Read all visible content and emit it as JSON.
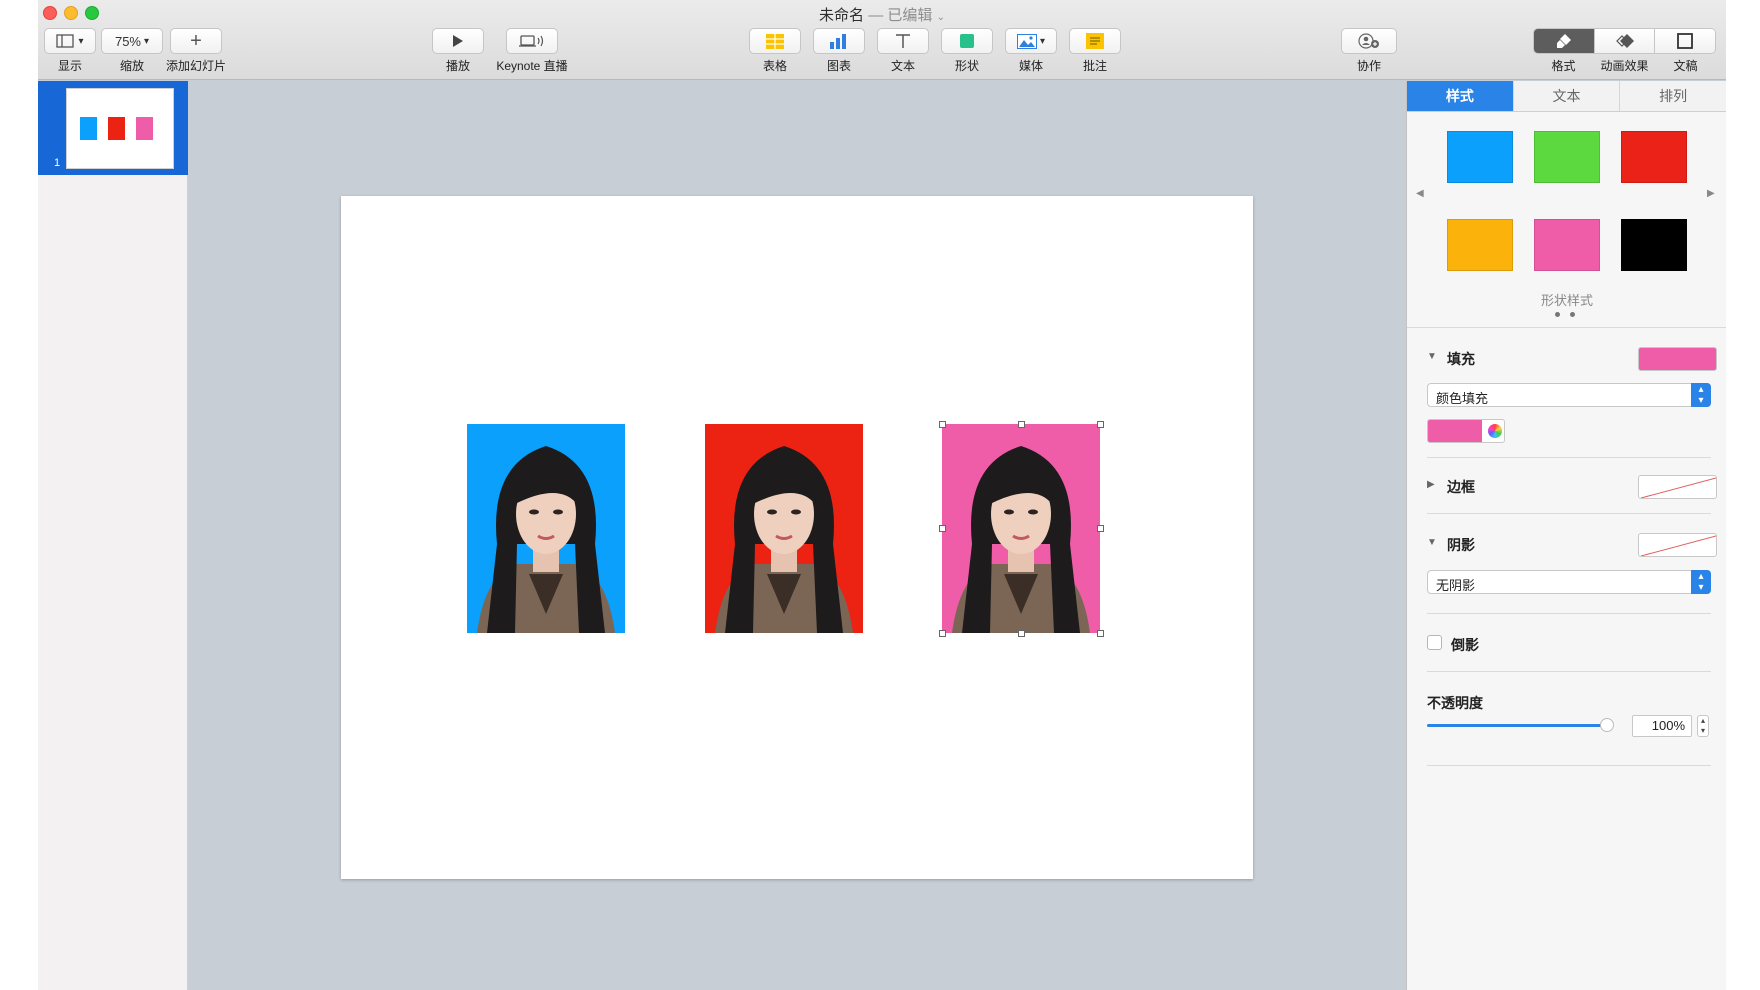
{
  "window": {
    "title": "未命名",
    "separator": " — ",
    "status": "已编辑"
  },
  "toolbar": {
    "view_label": "显示",
    "zoom_value": "75%",
    "zoom_label": "缩放",
    "add_slide_label": "添加幻灯片",
    "play_label": "播放",
    "live_label": "Keynote 直播",
    "table_label": "表格",
    "chart_label": "图表",
    "text_label": "文本",
    "shape_label": "形状",
    "media_label": "媒体",
    "comment_label": "批注",
    "collab_label": "协作",
    "format_label": "格式",
    "animate_label": "动画效果",
    "document_label": "文稿"
  },
  "navigator": {
    "slide_number": "1"
  },
  "slide": {
    "photos": [
      {
        "background": "#0aa0fb"
      },
      {
        "background": "#ec2213"
      },
      {
        "background": "#ef5ca8",
        "selected": true
      }
    ]
  },
  "inspector": {
    "tabs": [
      {
        "label": "样式",
        "active": true
      },
      {
        "label": "文本",
        "active": false
      },
      {
        "label": "排列",
        "active": false
      }
    ],
    "shape_styles_label": "形状样式",
    "style_swatches": [
      "#0aa0fb",
      "#5bd93f",
      "#ea2218",
      "#fbb30b",
      "#ef5ca8",
      "#000000"
    ],
    "fill": {
      "title": "填充",
      "color": "#ef5ca8",
      "type": "颜色填充"
    },
    "border": {
      "title": "边框"
    },
    "shadow": {
      "title": "阴影",
      "type": "无阴影"
    },
    "reflection": {
      "title": "倒影",
      "checked": false
    },
    "opacity": {
      "title": "不透明度",
      "value": "100%",
      "level": 1.0
    }
  }
}
